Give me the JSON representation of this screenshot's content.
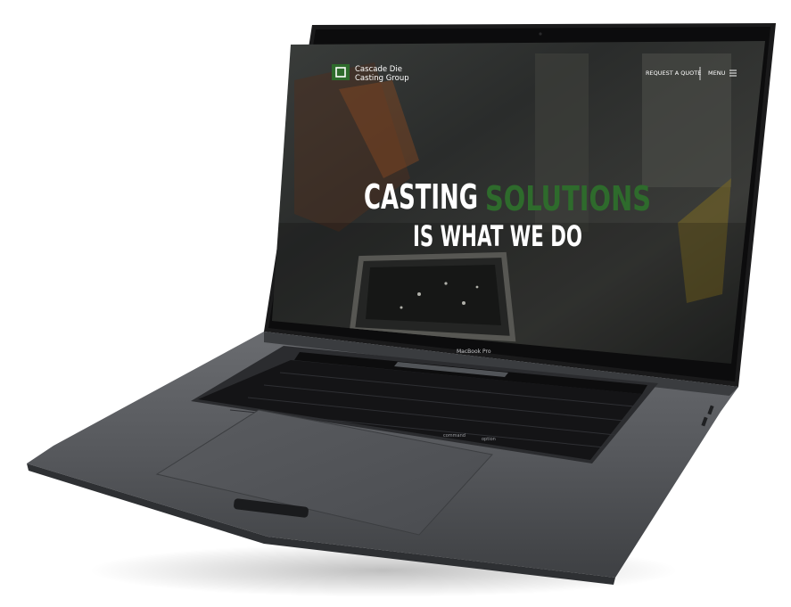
{
  "device": {
    "model_label": "MacBook Pro"
  },
  "website": {
    "brand": {
      "line1": "Cascade Die",
      "line2": "Casting Group"
    },
    "nav": {
      "request_quote": "REQUEST A QUOTE",
      "menu": "MENU"
    },
    "hero": {
      "headline_white": "CASTING",
      "headline_green": "SOLUTIONS",
      "subline": "IS WHAT WE DO"
    }
  },
  "keyboard": {
    "visible_key_labels": [
      "command",
      "option"
    ]
  },
  "colors": {
    "brand_green": "#2e6b2c",
    "laptop_body": "#5d5f62",
    "screen_bezel": "#0c0c0d"
  }
}
